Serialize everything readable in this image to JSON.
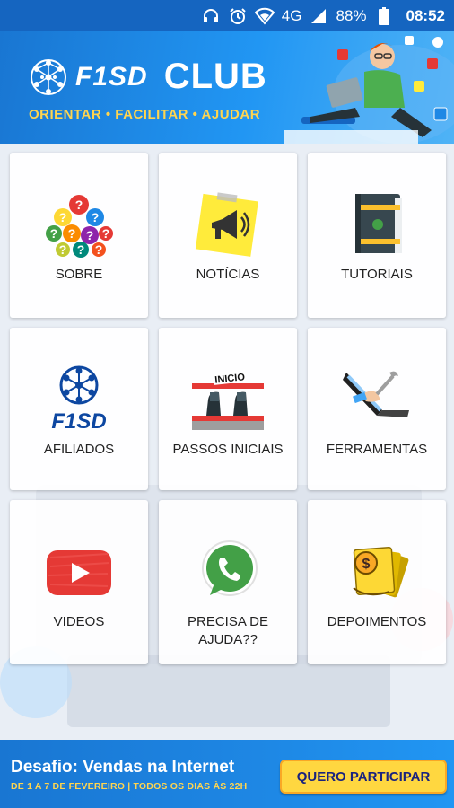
{
  "status_bar": {
    "network": "4G",
    "battery": "88%",
    "time": "08:52",
    "icons": [
      "headphones-icon",
      "alarm-icon",
      "wifi-icon",
      "signal-icon",
      "battery-icon"
    ]
  },
  "header": {
    "brand": "F1SD",
    "club": "CLUB",
    "tagline": "ORIENTAR • FACILITAR • AJUDAR"
  },
  "tiles": [
    {
      "label": "SOBRE",
      "icon": "question-marks-icon"
    },
    {
      "label": "NOTÍCIAS",
      "icon": "megaphone-note-icon"
    },
    {
      "label": "TUTORIAIS",
      "icon": "book-icon"
    },
    {
      "label": "AFILIADOS",
      "icon": "f1sd-logo-icon"
    },
    {
      "label": "PASSOS INICIAIS",
      "icon": "start-line-icon",
      "badge": "INICIO"
    },
    {
      "label": "FERRAMENTAS",
      "icon": "laptop-wrench-icon"
    },
    {
      "label": "VIDEOS",
      "icon": "youtube-icon"
    },
    {
      "label": "PRECISA DE\nAJUDA??",
      "icon": "whatsapp-icon"
    },
    {
      "label": "DEPOIMENTOS",
      "icon": "money-icon"
    }
  ],
  "bottom_banner": {
    "title": "Desafio: Vendas na Internet",
    "subtitle": "DE 1 A 7 DE FEVEREIRO | TODOS OS DIAS ÀS 22H",
    "button": "QUERO PARTICIPAR"
  },
  "colors": {
    "primary": "#1976d2",
    "accent": "#ffd54f",
    "button_text": "#1a237e"
  }
}
